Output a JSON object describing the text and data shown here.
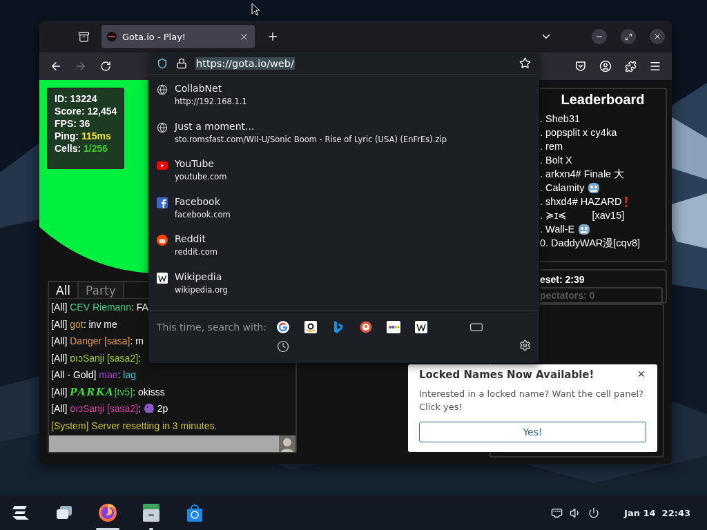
{
  "browser": {
    "tab": {
      "title": "Gota.io - Play!",
      "selected": true
    },
    "url": "https://gota.io/web/",
    "forward_disabled": true
  },
  "url_suggestions": [
    {
      "title": "CollabNet",
      "url": "http://192.168.1.1",
      "kind": "globe"
    },
    {
      "title": "Just a moment...",
      "url": "sto.romsfast.com/WII-U/Sonic Boom - Rise of Lyric (USA) (EnFrEs).zip",
      "kind": "globe"
    },
    {
      "title": "YouTube",
      "url": "youtube.com",
      "kind": "youtube"
    },
    {
      "title": "Facebook",
      "url": "facebook.com",
      "kind": "facebook"
    },
    {
      "title": "Reddit",
      "url": "reddit.com",
      "kind": "reddit"
    },
    {
      "title": "Wikipedia",
      "url": "wikipedia.org",
      "kind": "wikipedia"
    }
  ],
  "search_bar": {
    "label": "This time, search with:",
    "engines": [
      {
        "kind": "google"
      },
      {
        "kind": "amazon"
      },
      {
        "kind": "bing"
      },
      {
        "kind": "duckduckgo"
      },
      {
        "kind": "ebay"
      },
      {
        "kind": "wikipedia"
      },
      {
        "kind": "tabs"
      },
      {
        "kind": "history"
      }
    ]
  },
  "game": {
    "stats": [
      {
        "label": "ID: ",
        "value": "13224",
        "color": "#ffffff"
      },
      {
        "label": "Score: ",
        "value": "12,454",
        "color": "#ffffff"
      },
      {
        "label": "FPS: ",
        "value": "36",
        "color": "#ffffff"
      },
      {
        "label": "Ping: ",
        "value": "115ms",
        "color": "#eee52c"
      },
      {
        "label": "Cells: ",
        "value": "1/256",
        "color": "#3ccf2c"
      }
    ]
  },
  "leaderboard": {
    "title": "Leaderboard",
    "entries": [
      {
        "name": ". Sheb31",
        "kind": "plain"
      },
      {
        "name": ". popsplit x cy4ka",
        "kind": "plain"
      },
      {
        "name": ". rem",
        "kind": "plain"
      },
      {
        "name": ". Bolt X",
        "kind": "plain"
      },
      {
        "name": ". arkxn4# Finale 大",
        "kind": "plain"
      },
      {
        "name": ". Calamity",
        "kind": "robot"
      },
      {
        "name": ". shxd4# HAZARD",
        "kind": "alert"
      },
      {
        "name": ". ≽ɪ≼         [xav15]",
        "kind": "plain"
      },
      {
        "name": ". Wall-E",
        "kind": "robot"
      },
      {
        "name": "0. DaddyWAR漫[cqv8]",
        "kind": "plain"
      }
    ]
  },
  "status": {
    "reset": "eset: 2:39",
    "spectators": "pectators: 0"
  },
  "chat": {
    "tabs": [
      {
        "label": "All",
        "selected": true
      },
      {
        "label": "Party",
        "selected": false
      }
    ],
    "messages": [
      {
        "parts": [
          {
            "text": "[All] "
          },
          {
            "text": "CEV Riemann",
            "color": "#35d08a"
          },
          {
            "text": ": FA"
          }
        ]
      },
      {
        "parts": [
          {
            "text": "[All] "
          },
          {
            "text": "got",
            "color": "#d9a441"
          },
          {
            "text": ": inv me"
          }
        ]
      },
      {
        "parts": [
          {
            "text": "[All] "
          },
          {
            "text": "Danger [sasa]",
            "color": "#e39a4c"
          },
          {
            "text": ": m"
          }
        ]
      },
      {
        "parts": [
          {
            "text": "[All] "
          },
          {
            "text": "ɒıɔSanji [sasa2]",
            "color": "#9fd13a"
          },
          {
            "text": ":"
          }
        ]
      },
      {
        "parts": [
          {
            "text": "[All - Gold] "
          },
          {
            "text": "mae",
            "color": "#a040e0"
          },
          {
            "text": ": "
          },
          {
            "text": "lag",
            "color": "#35c8c8"
          }
        ]
      },
      {
        "parts": [
          {
            "text": "[All] "
          },
          {
            "text": "PARKA",
            "color": "#3cd43c",
            "kind": "fancy"
          },
          {
            "text": "[tv5]",
            "color": "#3cd43c"
          },
          {
            "text": ": okisss"
          }
        ]
      },
      {
        "parts": [
          {
            "text": "[All] "
          },
          {
            "text": "ɒıɔSanji [sasa2]",
            "color": "#d63fb0"
          },
          {
            "text": ": "
          },
          {
            "kind": "emoji"
          },
          {
            "text": " 2p"
          }
        ]
      },
      {
        "parts": [
          {
            "text": "[System] Server resetting in 3 minutes.",
            "color": "#c8c41e"
          }
        ]
      }
    ]
  },
  "popup": {
    "title": "Locked Names Now Available!",
    "close": "×",
    "body": "Interested in a locked name? Want the cell panel? Click yes!",
    "button": "Yes!"
  },
  "taskbar": {
    "apps": [
      {
        "kind": "zorin",
        "selected": false,
        "running": false
      },
      {
        "kind": "windows",
        "selected": false,
        "running": false
      },
      {
        "kind": "firefox",
        "selected": true
      },
      {
        "kind": "files",
        "selected": false,
        "running": true
      },
      {
        "kind": "store",
        "selected": false,
        "running": false
      }
    ],
    "date": "Jan 14",
    "time": "22:43"
  }
}
